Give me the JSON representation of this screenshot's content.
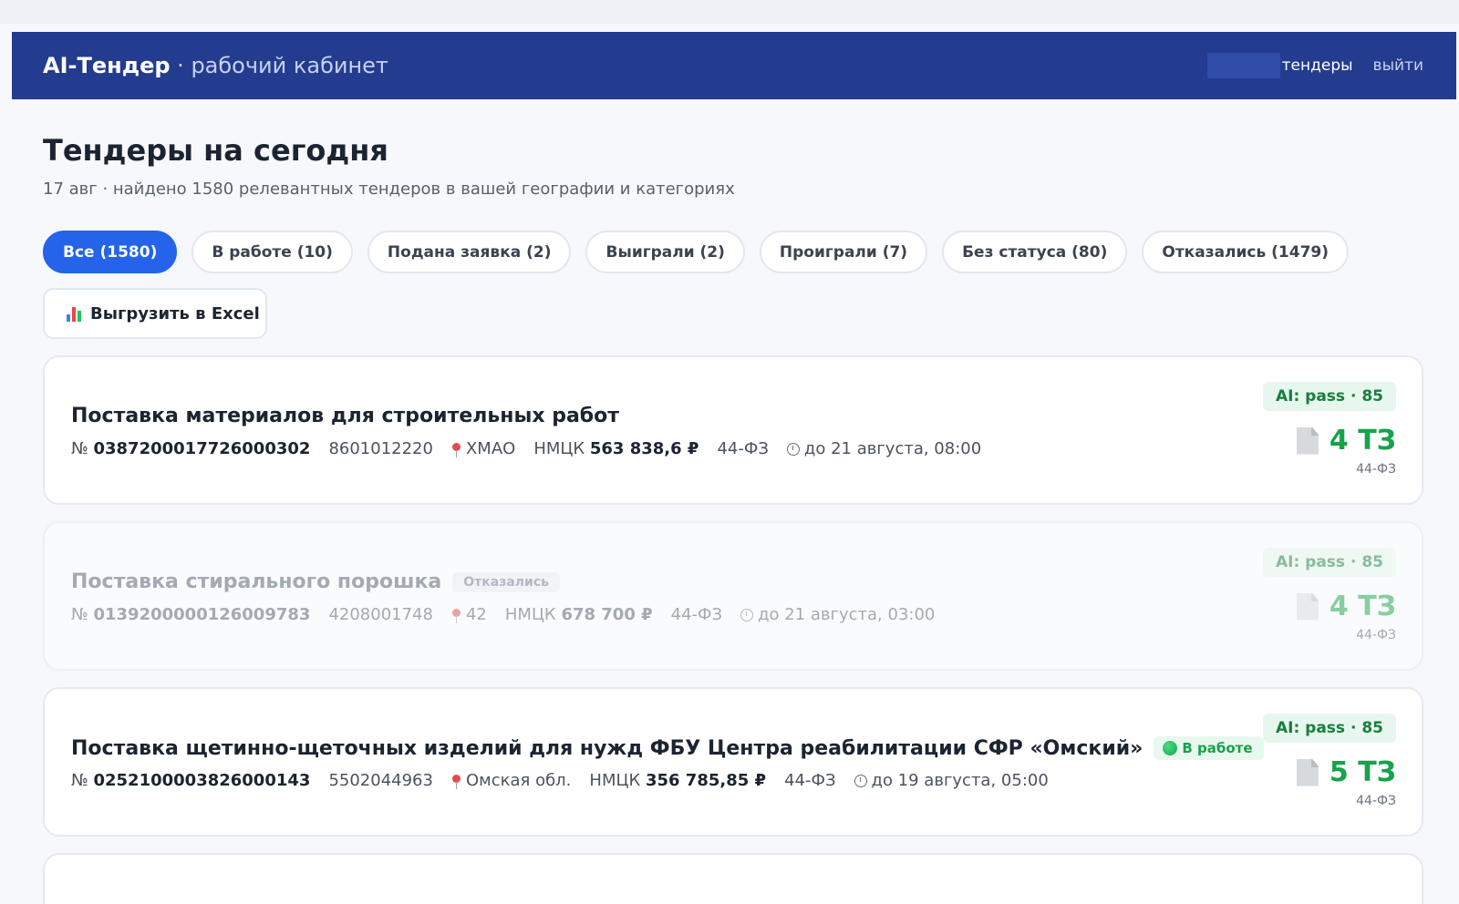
{
  "header": {
    "brand": "AI-Тендер",
    "brand_sep": " · ",
    "brand_sub": "рабочий кабинет",
    "nav_tenders": "тендеры",
    "nav_exit": "выйти"
  },
  "page": {
    "title": "Тендеры на сегодня",
    "subtitle": "17 авг · найдено 1580 релевантных тендеров в вашей географии и категориях"
  },
  "filters": [
    {
      "label": "Все (1580)",
      "active": true
    },
    {
      "label": "В работе (10)"
    },
    {
      "label": "Подана заявка (2)"
    },
    {
      "label": "Выиграли (2)"
    },
    {
      "label": "Проиграли (7)"
    },
    {
      "label": "Без статуса (80)"
    },
    {
      "label": "Отказались (1479)"
    }
  ],
  "export": {
    "label": "Выгрузить в Excel",
    "icon": "bar-chart-icon"
  },
  "colors": {
    "header": "#233c8f",
    "accent": "#2563eb",
    "success": "#16a34a"
  },
  "tenders": [
    {
      "title": "Поставка материалов для строительных работ",
      "badge": "",
      "number_prefix": "№",
      "number": "0387200017726000302",
      "inn": "8601012220",
      "region": "ХМАО",
      "nmck_label": "НМЦК",
      "nmck": "563 838,6 ₽",
      "law": "44-ФЗ",
      "deadline": "до 21 августа, 08:00",
      "ai": "AI: pass · 85",
      "tz": "4 ТЗ",
      "tz_law": "44-ФЗ"
    },
    {
      "title": "Поставка стирального порошка",
      "badge": "Отказались",
      "number_prefix": "№",
      "number": "0139200000126009783",
      "inn": "4208001748",
      "region": "42",
      "nmck_label": "НМЦК",
      "nmck": "678 700 ₽",
      "law": "44-ФЗ",
      "deadline": "до 21 августа, 03:00",
      "ai": "AI: pass · 85",
      "tz": "4 ТЗ",
      "tz_law": "44-ФЗ"
    },
    {
      "title": "Поставка щетинно-щеточных изделий для нужд ФБУ Центра реабилитации СФР «Омский»",
      "badge": "В работе",
      "number_prefix": "№",
      "number": "0252100003826000143",
      "inn": "5502044963",
      "region": "Омская обл.",
      "nmck_label": "НМЦК",
      "nmck": "356 785,85 ₽",
      "law": "44-ФЗ",
      "deadline": "до 19 августа, 05:00",
      "ai": "AI: pass · 85",
      "tz": "5 ТЗ",
      "tz_law": "44-ФЗ"
    }
  ]
}
